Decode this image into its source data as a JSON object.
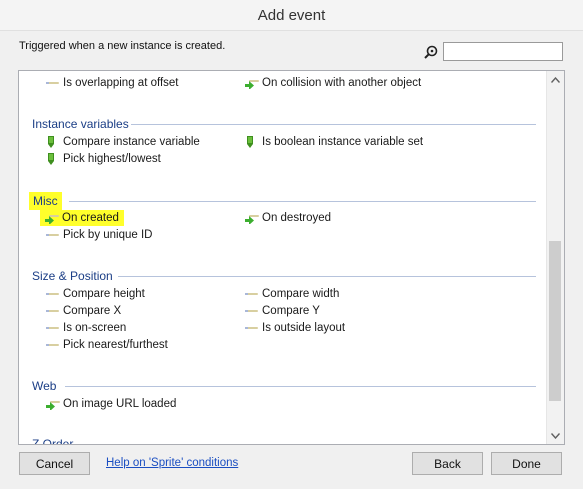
{
  "window": {
    "title": "Add event"
  },
  "description": "Triggered when a new instance is created.",
  "search": {
    "value": "",
    "icon": "search-icon"
  },
  "colors": {
    "category": "#1b3e86",
    "highlight": "#ffff2b",
    "link": "#1a4ec2"
  },
  "categories": [
    {
      "name": "",
      "items": [
        {
          "label": "Is overlapping at offset",
          "icon": "condition-icon"
        },
        {
          "label": "On collision with another object",
          "icon": "trigger-arrow-icon"
        }
      ]
    },
    {
      "name": "Instance variables",
      "items": [
        {
          "label": "Compare instance variable",
          "icon": "variable-icon"
        },
        {
          "label": "Is boolean instance variable set",
          "icon": "variable-icon"
        },
        {
          "label": "Pick highest/lowest",
          "icon": "variable-icon"
        }
      ]
    },
    {
      "name": "Misc",
      "items": [
        {
          "label": "On created",
          "icon": "trigger-arrow-icon"
        },
        {
          "label": "On destroyed",
          "icon": "trigger-arrow-icon"
        },
        {
          "label": "Pick by unique ID",
          "icon": "condition-icon"
        }
      ]
    },
    {
      "name": "Size & Position",
      "items": [
        {
          "label": "Compare height",
          "icon": "condition-icon"
        },
        {
          "label": "Compare width",
          "icon": "condition-icon"
        },
        {
          "label": "Compare X",
          "icon": "condition-icon"
        },
        {
          "label": "Compare Y",
          "icon": "condition-icon"
        },
        {
          "label": "Is on-screen",
          "icon": "condition-icon"
        },
        {
          "label": "Is outside layout",
          "icon": "condition-icon"
        },
        {
          "label": "Pick nearest/furthest",
          "icon": "condition-icon"
        }
      ]
    },
    {
      "name": "Web",
      "items": [
        {
          "label": "On image URL loaded",
          "icon": "trigger-arrow-icon"
        }
      ]
    },
    {
      "name": "Z Order",
      "items": []
    }
  ],
  "buttons": {
    "cancel": "Cancel",
    "help": "Help on 'Sprite' conditions",
    "back": "Back",
    "done": "Done"
  }
}
